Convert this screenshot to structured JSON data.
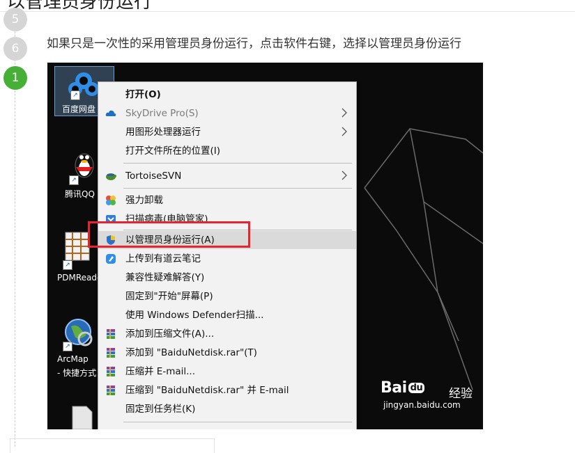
{
  "page": {
    "title": "以管理员身份运行",
    "steps": [
      "5",
      "6",
      "1"
    ],
    "step_text": "如果只是一次性的采用管理员身份运行，点击软件右键，选择以管理员身份运行"
  },
  "desktop": {
    "icons": [
      {
        "label": "百度网盘",
        "icon": "baidu-netdisk-icon"
      },
      {
        "label": "腾讯QQ",
        "icon": "qq-penguin-icon"
      },
      {
        "label": "PDMReader",
        "icon": "pdmreader-icon"
      },
      {
        "label": "ArcMap",
        "label2": "- 快捷方式",
        "icon": "arcmap-globe-icon"
      }
    ]
  },
  "context_menu": {
    "items": [
      {
        "label": "打开(O)",
        "bold": true
      },
      {
        "label": "SkyDrive Pro(S)",
        "icon": "skydrive-cloud-icon",
        "disabled": true,
        "submenu": true
      },
      {
        "label": "用图形处理器运行",
        "submenu": true
      },
      {
        "label": "打开文件所在的位置(I)"
      },
      {
        "label": "TortoiseSVN",
        "icon": "tortoisesvn-icon",
        "submenu": true
      },
      {
        "label": "强力卸载",
        "icon": "uninstall-icon"
      },
      {
        "label": "扫描病毒(电脑管家)",
        "icon": "shield-scan-icon"
      },
      {
        "label": "以管理员身份运行(A)",
        "icon": "uac-shield-icon",
        "highlighted": true
      },
      {
        "label": "上传到有道云笔记",
        "icon": "youdao-note-icon"
      },
      {
        "label": "兼容性疑难解答(Y)"
      },
      {
        "label": "固定到\"开始\"屏幕(P)"
      },
      {
        "label": "使用 Windows Defender扫描..."
      },
      {
        "label": "添加到压缩文件(A)...",
        "icon": "winrar-icon"
      },
      {
        "label": "添加到 \"BaiduNetdisk.rar\"(T)",
        "icon": "winrar-icon"
      },
      {
        "label": "压缩并 E-mail...",
        "icon": "winrar-icon"
      },
      {
        "label": "压缩到 \"BaiduNetdisk.rar\" 并 E-mail",
        "icon": "winrar-icon"
      },
      {
        "label": "固定到任务栏(K)"
      }
    ]
  },
  "watermark": {
    "logo": "Bai",
    "logo_du": "du",
    "logo_cn": "经验",
    "url": "jingyan.baidu.com"
  },
  "colors": {
    "accent_green": "#45b035",
    "badge_gray": "#d5d5d5",
    "highlight_red": "#e8242f"
  }
}
